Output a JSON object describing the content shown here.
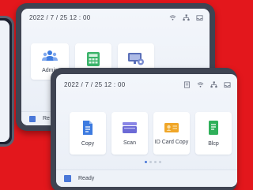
{
  "back_device": {
    "time": "2022 / 7 / 25   12 : 00",
    "tiles": [
      {
        "label": "Admin",
        "icon": "admin-users-icon"
      },
      {
        "label": "",
        "icon": "calculator-icon"
      },
      {
        "label": "",
        "icon": "monitor-settings-icon"
      }
    ],
    "footer_text": "Re"
  },
  "front_device": {
    "time": "2022 / 7 / 25   12 : 00",
    "tiles": [
      {
        "label": "Copy",
        "icon": "copy-document-icon"
      },
      {
        "label": "Scan",
        "icon": "scan-icon"
      },
      {
        "label": "ID Card Copy",
        "icon": "id-card-icon"
      },
      {
        "label": "Blcp",
        "icon": "green-document-icon"
      }
    ],
    "footer_text": "Ready",
    "page_count": 4,
    "active_page": 1
  },
  "colors": {
    "background": "#e3171c",
    "accent": "#4a78d8",
    "copy_blue": "#3d7be0",
    "scan_purple": "#6c6ad6",
    "id_orange": "#f0a628",
    "doc_green": "#2fb05a",
    "calc_green": "#3bb36a"
  }
}
